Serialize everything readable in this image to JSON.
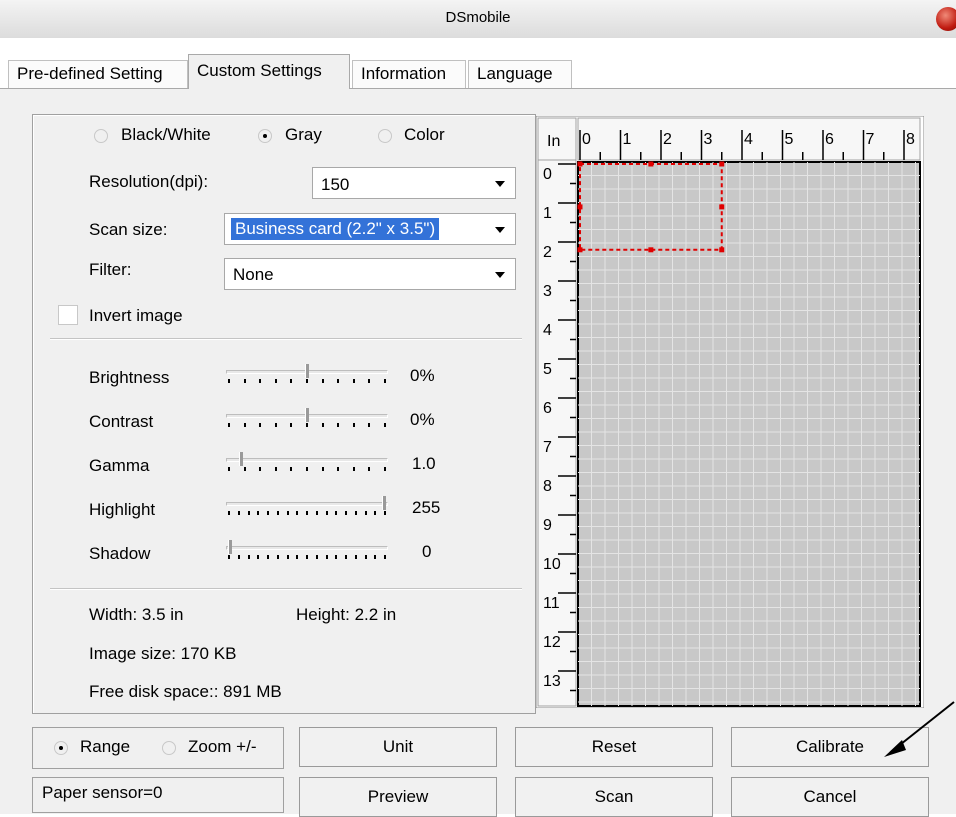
{
  "window": {
    "title": "DSmobile"
  },
  "tabs": [
    "Pre-defined Setting",
    "Custom Settings",
    "Information",
    "Language"
  ],
  "color_mode": {
    "options": [
      "Black/White",
      "Gray",
      "Color"
    ],
    "selected": "Gray"
  },
  "resolution": {
    "label": "Resolution(dpi):",
    "value": "150"
  },
  "scan_size": {
    "label": "Scan size:",
    "value": "Business card (2.2\" x 3.5\")"
  },
  "filter": {
    "label": "Filter:",
    "value": "None"
  },
  "invert_image": {
    "label": "Invert image",
    "checked": false
  },
  "sliders": [
    {
      "label": "Brightness",
      "value": "0%",
      "level": 0.5
    },
    {
      "label": "Contrast",
      "value": "0%",
      "level": 0.5
    },
    {
      "label": "Gamma",
      "value": "1.0",
      "level": 0.07
    },
    {
      "label": "Highlight",
      "value": "255",
      "level": 1.0
    },
    {
      "label": "Shadow",
      "value": "0",
      "level": 0.0
    }
  ],
  "info": {
    "width": "Width:  3.5 in",
    "height": "Height:  2.2 in",
    "image_size": "Image size: 170 KB",
    "free_disk": "Free disk space:: 891 MB"
  },
  "preview": {
    "unit": "In",
    "x_ruler": [
      "0",
      "1",
      "2",
      "3",
      "4",
      "5",
      "6",
      "7",
      "8"
    ],
    "y_ruler": [
      "0",
      "1",
      "2",
      "3",
      "4",
      "5",
      "6",
      "7",
      "8",
      "9",
      "10",
      "11",
      "12",
      "13"
    ],
    "selection_color": "#e00000"
  },
  "mode": {
    "options": [
      "Range",
      "Zoom +/-"
    ],
    "selected": "Range"
  },
  "status": {
    "text": "Paper sensor=0"
  },
  "buttons": {
    "unit": "Unit",
    "reset": "Reset",
    "calibrate": "Calibrate",
    "preview": "Preview",
    "scan": "Scan",
    "cancel": "Cancel"
  },
  "colors": {
    "selection_bg": "#3372d8",
    "preview_bg": "#c8c8c8",
    "grid": "#e4e4e4"
  }
}
